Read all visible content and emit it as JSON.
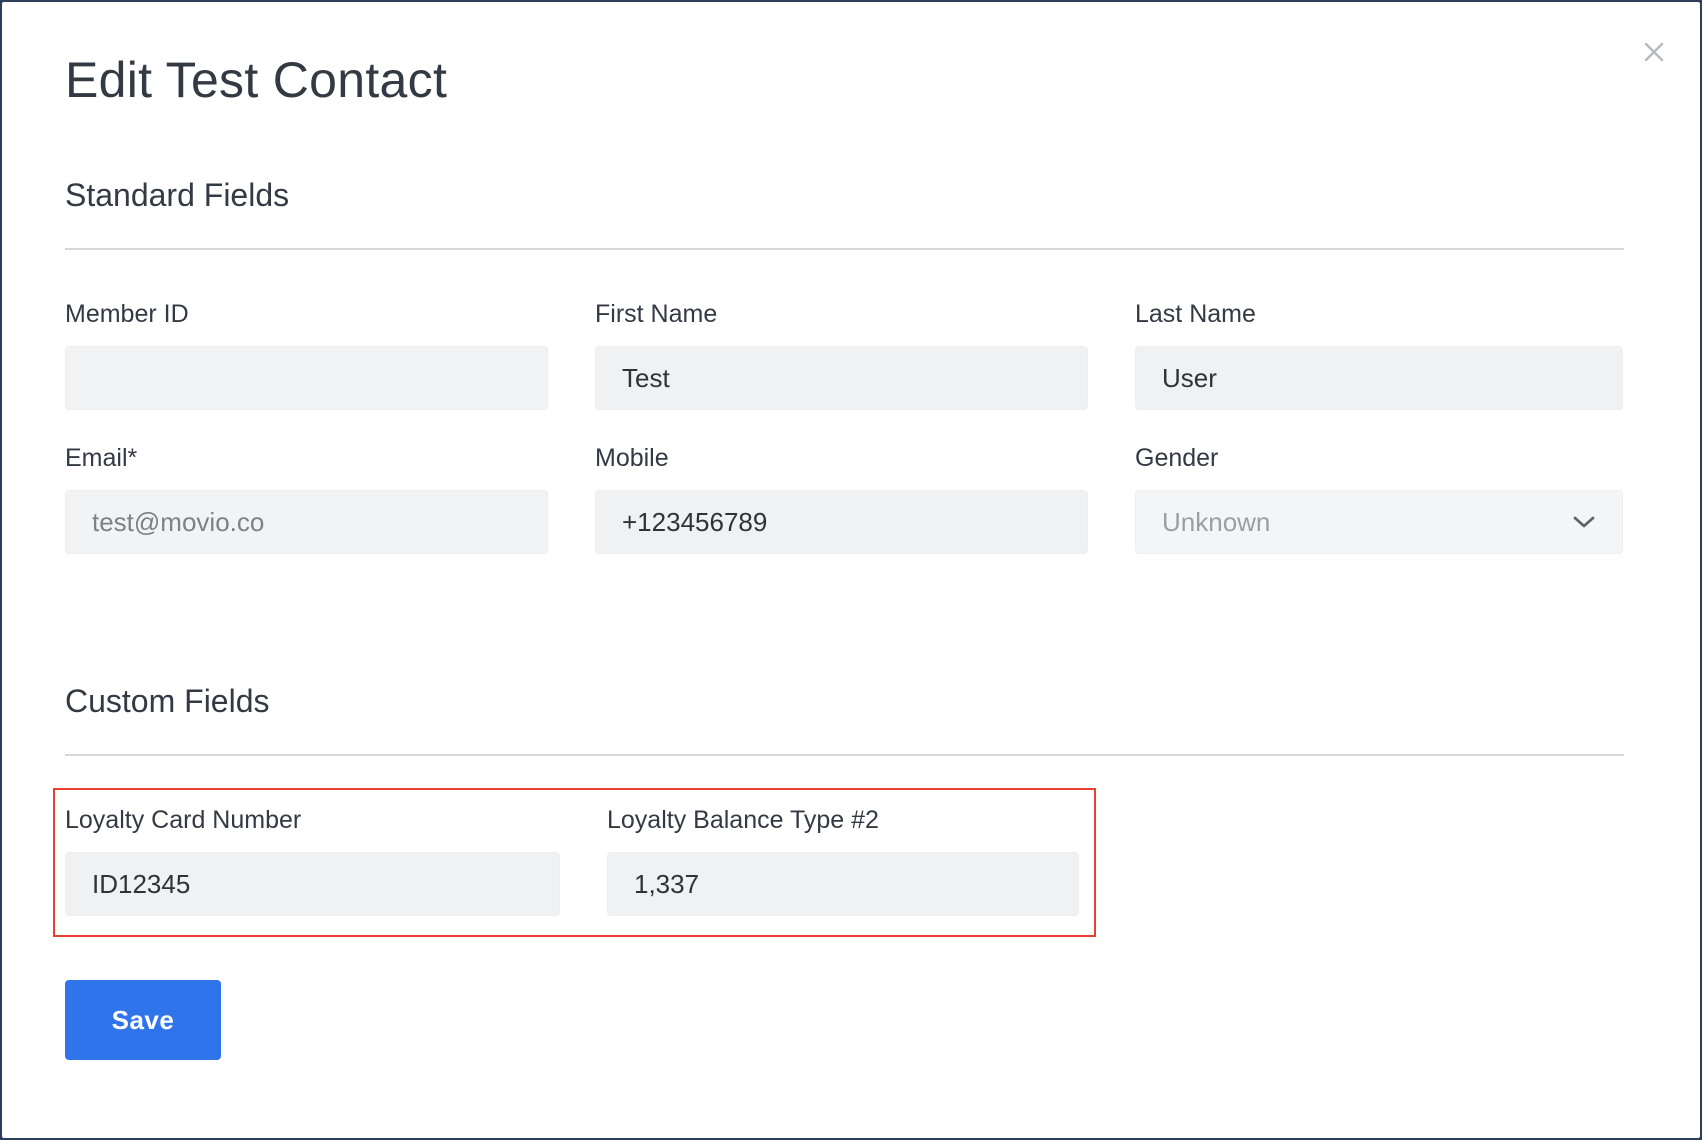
{
  "modal": {
    "title": "Edit Test Contact",
    "close_icon": "close-icon"
  },
  "standard_fields": {
    "heading": "Standard Fields",
    "member_id": {
      "label": "Member ID",
      "value": ""
    },
    "first_name": {
      "label": "First Name",
      "value": "Test"
    },
    "last_name": {
      "label": "Last Name",
      "value": "User"
    },
    "email": {
      "label": "Email*",
      "value": "test@movio.co"
    },
    "mobile": {
      "label": "Mobile",
      "value": "+123456789"
    },
    "gender": {
      "label": "Gender",
      "value": "Unknown",
      "icon": "chevron-down-icon"
    }
  },
  "custom_fields": {
    "heading": "Custom Fields",
    "loyalty_card_number": {
      "label": "Loyalty Card Number",
      "value": "ID12345"
    },
    "loyalty_balance_type_2": {
      "label": "Loyalty Balance Type #2",
      "value": "1,337"
    }
  },
  "actions": {
    "save_label": "Save"
  },
  "colors": {
    "primary_button": "#2f74eb",
    "highlight_border": "#e8412f",
    "input_background": "#f0f1f2",
    "text": "#333a44"
  }
}
